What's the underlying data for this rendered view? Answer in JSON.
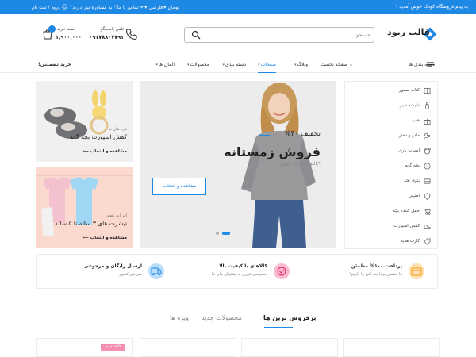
{
  "topbar": {
    "welcome": "به پیام فروشگاه کودک خوش آمدید !",
    "currency": "تومان",
    "language": "فارسی",
    "contact": "تماس با ما",
    "help": "به مشاوره نیاز دارید؟",
    "auth": "ورود / ثبت نام"
  },
  "header": {
    "logo_text": "قالب ریود",
    "search_placeholder": "جستجو ...",
    "phone_label": "تلفن پاسخگو",
    "phone_number": "۰۹۱۷۸۸۰۷۷۹۱",
    "cart_label": "سبد خرید",
    "cart_total": "۱,۹۰۰,۰۰۰",
    "cart_count": "۰"
  },
  "nav": {
    "categories": "دسته بندی ها",
    "items": [
      "صفحه نخست",
      "وبلاگ",
      "صفحات",
      "دسته بندی",
      "محصولات",
      "المان ها"
    ],
    "active_index": 2,
    "special_offer": "خرید تضمینی!"
  },
  "sidebar": {
    "items": [
      {
        "label": "کتاب مصور",
        "icon": "book-icon"
      },
      {
        "label": "شیشه شیر",
        "icon": "bottle-icon"
      },
      {
        "label": "هدیه",
        "icon": "gift-icon"
      },
      {
        "label": "مادر و دختر",
        "icon": "mother-daughter-icon"
      },
      {
        "label": "اسباب بازی",
        "icon": "toy-icon"
      },
      {
        "label": "بچه گانه",
        "icon": "baby-icon"
      },
      {
        "label": "پتوی بچه",
        "icon": "blanket-icon"
      },
      {
        "label": "امنیتی",
        "icon": "shield-icon"
      },
      {
        "label": "حمل کننده بچه",
        "icon": "stroller-icon"
      },
      {
        "label": "کفش اسپورت",
        "icon": "shoe-icon"
      },
      {
        "label": "کارت هدیه",
        "icon": "tag-icon"
      }
    ]
  },
  "hero": {
    "discount": "تخفیف ۴۰%",
    "title": "فروش زمستانه",
    "subtitle": "*پالتو ، پاپوش ،بوتین*",
    "button": "مشاهده و انتخاب"
  },
  "promos": [
    {
      "kicker": "تازه های ما",
      "title": "کفش اسپورت بچه گانه",
      "link": "مشاهده و انتخاب"
    },
    {
      "kicker": "آفر این هفته",
      "title": "تیشرت های ۳ ساله تا ۵ ساله",
      "link": "مشاهده و انتخاب"
    }
  ],
  "features": [
    {
      "title": "پرداخت ۱۰۰% مطمئن",
      "sub": "ما تضمین پرداخت امن را داریم!",
      "icon": "wallet-icon",
      "color": "#ffe0b2"
    },
    {
      "title": "کالاهای با کیفیت بالا",
      "sub": "دسترسی فوری به پشتیبان های ما",
      "icon": "quality-icon",
      "color": "#f8bbd0"
    },
    {
      "title": "ارسال رایگان و مرجوعی",
      "sub": "سراسر کشور",
      "icon": "shipping-icon",
      "color": "#bbdefb"
    }
  ],
  "tabs": [
    "پرفروش ترین ها",
    "محصولات جدید",
    "ویژه ها"
  ],
  "product_badge": "۲۷% تخفیف",
  "colors": {
    "accent": "#1e88e5",
    "promo_pink": "#fbd9cf"
  }
}
